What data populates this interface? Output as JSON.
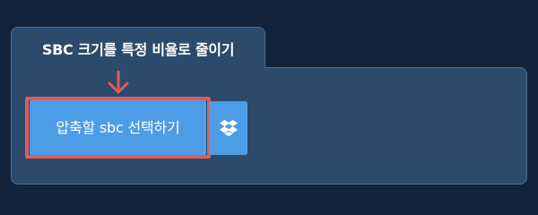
{
  "panel": {
    "title": "SBC 크기를 특정 비율로 줄이기"
  },
  "file_picker": {
    "select_label": "압축할 sbc 선택하기",
    "dropbox_icon": "dropbox-icon",
    "arrow_icon": "arrow-down-icon"
  },
  "colors": {
    "page_background": "#13243a",
    "panel_background": "#2c4a6b",
    "button_background": "#4d9de6",
    "highlight": "#e05a5a"
  }
}
